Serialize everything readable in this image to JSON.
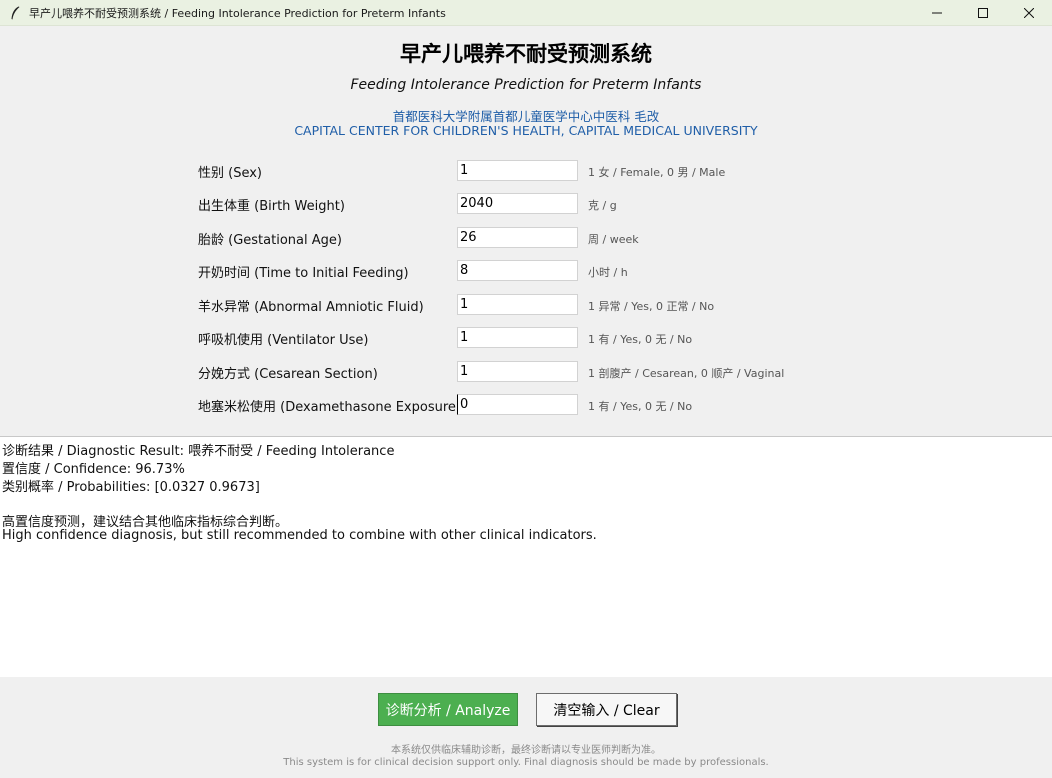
{
  "window": {
    "title": "早产儿喂养不耐受预测系统 / Feeding Intolerance Prediction for Preterm Infants",
    "icons": {
      "app": "feather-icon",
      "minimize": "minimize-icon",
      "maximize": "maximize-icon",
      "close": "close-icon"
    }
  },
  "header": {
    "title": "早产儿喂养不耐受预测系统",
    "subtitle": "Feeding Intolerance Prediction for Preterm Infants",
    "institution_cn": "首都医科大学附属首都儿童医学中心中医科 毛改",
    "institution_en": "CAPITAL CENTER FOR CHILDREN'S HEALTH, CAPITAL MEDICAL UNIVERSITY"
  },
  "form": {
    "fields": [
      {
        "label": "性别 (Sex)",
        "value": "1",
        "hint": "1 女 / Female, 0 男 / Male"
      },
      {
        "label": "出生体重 (Birth Weight)",
        "value": "2040",
        "hint": "克 / g"
      },
      {
        "label": "胎龄 (Gestational Age)",
        "value": "26",
        "hint": "周 / week"
      },
      {
        "label": "开奶时间 (Time to Initial Feeding)",
        "value": "8",
        "hint": "小时 / h"
      },
      {
        "label": "羊水异常 (Abnormal Amniotic Fluid)",
        "value": "1",
        "hint": "1 异常 / Yes, 0 正常 / No"
      },
      {
        "label": "呼吸机使用 (Ventilator Use)",
        "value": "1",
        "hint": "1 有 / Yes, 0 无 / No"
      },
      {
        "label": "分娩方式 (Cesarean Section)",
        "value": "1",
        "hint": "1 剖腹产 / Cesarean, 0 顺产 / Vaginal"
      },
      {
        "label": "地塞米松使用 (Dexamethasone Exposure)",
        "value": "0",
        "hint": "1 有 / Yes, 0 无 / No"
      }
    ]
  },
  "result": {
    "diagnosis": "诊断结果 / Diagnostic Result: 喂养不耐受 / Feeding Intolerance",
    "confidence": "置信度 / Confidence: 96.73%",
    "probabilities": "类别概率 / Probabilities: [0.0327 0.9673]",
    "advice_cn": "高置信度预测，建议结合其他临床指标综合判断。",
    "advice_en": "High confidence diagnosis, but still recommended to combine with other clinical indicators."
  },
  "actions": {
    "analyze_label": "诊断分析 / Analyze",
    "clear_label": "清空输入 / Clear"
  },
  "footer": {
    "disclaimer_cn": "本系统仅供临床辅助诊断，最终诊断请以专业医师判断为准。",
    "disclaimer_en": "This system is for clinical decision support only. Final diagnosis should be made by professionals."
  },
  "colors": {
    "accent": "#4caf50",
    "institution": "#1f5ea8",
    "panel": "#f0f0f0"
  }
}
